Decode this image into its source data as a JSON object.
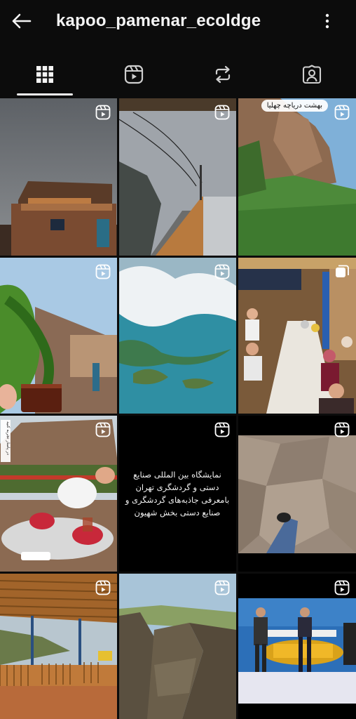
{
  "header": {
    "username": "kapoo_pamenar_ecoldge",
    "back_icon": "arrow-left-icon",
    "more_icon": "more-vertical-icon"
  },
  "tabs": [
    {
      "name": "grid",
      "icon": "grid-icon",
      "selected": true
    },
    {
      "name": "reels",
      "icon": "reels-icon",
      "selected": false
    },
    {
      "name": "reposts",
      "icon": "repost-icon",
      "selected": false
    },
    {
      "name": "tagged",
      "icon": "tagged-person-icon",
      "selected": false
    }
  ],
  "posts": [
    {
      "kind": "reel",
      "scene": "stone house under grey sky"
    },
    {
      "kind": "reel",
      "scene": "rainy road with power lines"
    },
    {
      "kind": "reel",
      "scene": "green mountain cliffs",
      "label": "بهشت دریاچه چهلیا"
    },
    {
      "kind": "reel",
      "scene": "plant with tea glass"
    },
    {
      "kind": "reel",
      "scene": "aerial view of lake and clouds"
    },
    {
      "kind": "carousel",
      "scene": "group dinner on floor cloth"
    },
    {
      "kind": "reel",
      "scene": "teapot and tea glasses",
      "side_caption": "در پامنار تجربه کنید"
    },
    {
      "kind": "reel",
      "scene": "text post",
      "text": "نمایشگاه بین المللی صنایع دستی و گردشگری تهران بامعرفی جاذبه‌های گردشگری و صنایع دستی بخش شهیون"
    },
    {
      "kind": "reel",
      "scene": "stone floor with shoe"
    },
    {
      "kind": "reel",
      "scene": "wooden terrace"
    },
    {
      "kind": "reel",
      "scene": "canyon cliffs"
    },
    {
      "kind": "reel",
      "scene": "tv studio interview"
    }
  ],
  "colors": {
    "background": "#0c0c0c",
    "text": "#f4f4f4",
    "tab_indicator": "#f2f2f2"
  }
}
